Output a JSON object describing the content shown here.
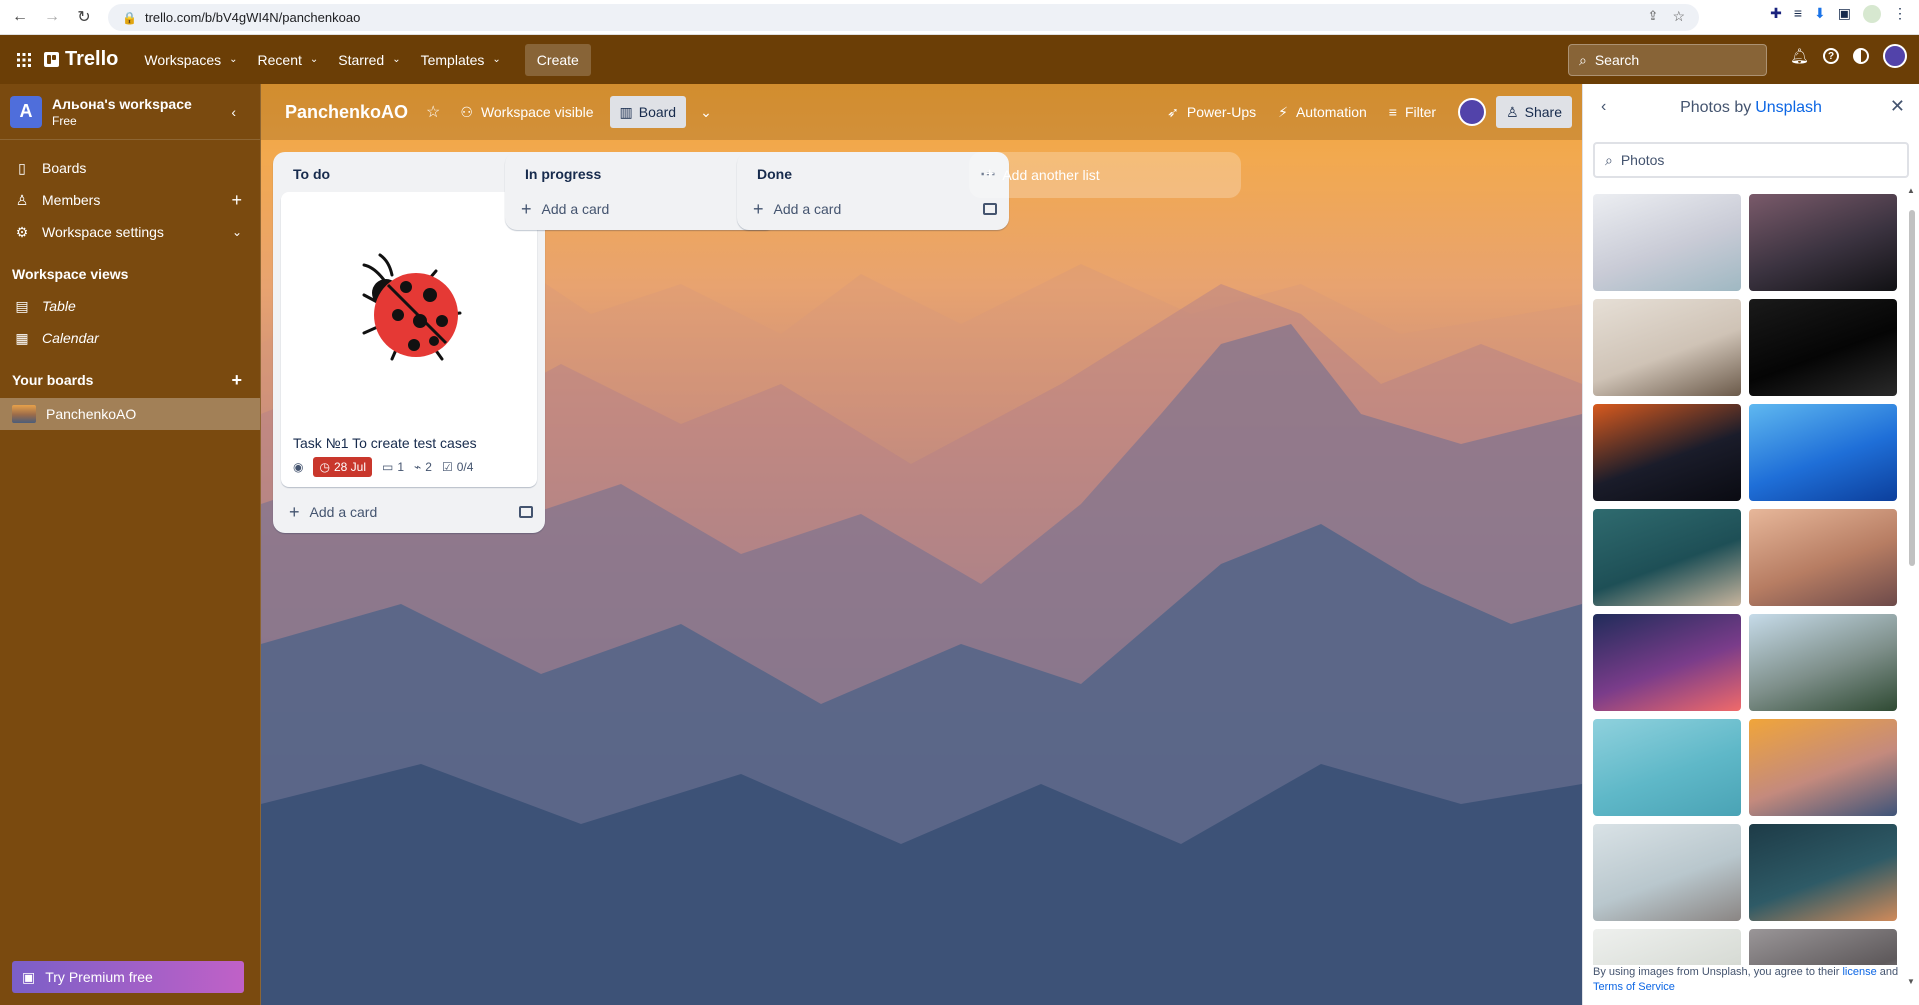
{
  "browser": {
    "url": "trello.com/b/bV4gWI4N/panchenkoao"
  },
  "header": {
    "logo": "Trello",
    "menus": [
      "Workspaces",
      "Recent",
      "Starred",
      "Templates"
    ],
    "create_label": "Create",
    "search_placeholder": "Search"
  },
  "sidebar": {
    "workspace_initial": "A",
    "workspace_name": "Альона's workspace",
    "workspace_plan": "Free",
    "items": [
      {
        "label": "Boards",
        "icon": "board-icon"
      },
      {
        "label": "Members",
        "icon": "person-icon"
      },
      {
        "label": "Workspace settings",
        "icon": "gear-icon"
      }
    ],
    "views_title": "Workspace views",
    "views": [
      {
        "label": "Table",
        "icon": "table-icon"
      },
      {
        "label": "Calendar",
        "icon": "calendar-icon"
      }
    ],
    "boards_title": "Your boards",
    "boards": [
      {
        "label": "PanchenkoAO"
      }
    ],
    "premium_label": "Try Premium free"
  },
  "board": {
    "title": "PanchenkoAO",
    "visibility": "Workspace visible",
    "view": "Board",
    "powerups": "Power-Ups",
    "automation": "Automation",
    "filter": "Filter",
    "share": "Share",
    "lists": [
      {
        "name": "To do",
        "cards": [
          {
            "title": "Task №1 To create test cases",
            "due": "28 Jul",
            "comments": "1",
            "attachments": "2",
            "checklist": "0/4"
          }
        ],
        "add_card": "Add a card"
      },
      {
        "name": "In progress",
        "cards": [],
        "add_card": "Add a card"
      },
      {
        "name": "Done",
        "cards": [],
        "add_card": "Add a card"
      }
    ],
    "add_list": "Add another list"
  },
  "panel": {
    "title_prefix": "Photos by",
    "title_link": "Unsplash",
    "search_placeholder": "Photos",
    "footer_text": "By using images from Unsplash, you agree to their",
    "footer_license": "license",
    "footer_and": "and",
    "footer_terms": "Terms of Service",
    "photos": [
      {
        "name": "photo-silver-waves",
        "colors": [
          "#eceef2",
          "#c9cbd6",
          "#9fb8c2"
        ]
      },
      {
        "name": "photo-dark-mountains-dusk",
        "colors": [
          "#7a5a6a",
          "#3b3340",
          "#111114"
        ]
      },
      {
        "name": "photo-rocky-peak",
        "colors": [
          "#e6dfd6",
          "#cfc3b6",
          "#6b5a4a"
        ]
      },
      {
        "name": "photo-glass-cube",
        "colors": [
          "#1a1a1a",
          "#050505",
          "#2a2a2a"
        ]
      },
      {
        "name": "photo-eclipse-planet",
        "colors": [
          "#d85a1e",
          "#1a1c2a",
          "#0a0b12"
        ]
      },
      {
        "name": "photo-blue-abstract",
        "colors": [
          "#5fb8f0",
          "#1f6fd8",
          "#0c3f9c"
        ]
      },
      {
        "name": "photo-teal-sea-rock",
        "colors": [
          "#2f6b6f",
          "#1e4f56",
          "#c7b49d"
        ]
      },
      {
        "name": "photo-sunset-mountain",
        "colors": [
          "#e7b79a",
          "#b77d63",
          "#6d4a4a"
        ]
      },
      {
        "name": "photo-dark-gradient",
        "colors": [
          "#202c5a",
          "#7a3c8a",
          "#f06a6a"
        ]
      },
      {
        "name": "photo-snowy-forest",
        "colors": [
          "#c6dbe9",
          "#7e8f8a",
          "#2f4a33"
        ]
      },
      {
        "name": "photo-palm-trees",
        "colors": [
          "#8fd1dd",
          "#5fb8c8",
          "#4aa3b5"
        ]
      },
      {
        "name": "photo-orange-ridges",
        "colors": [
          "#f0a53a",
          "#c48a7d",
          "#3f5479"
        ]
      },
      {
        "name": "photo-misty-peak",
        "colors": [
          "#d9e2e6",
          "#b9c7cd",
          "#8a8583"
        ]
      },
      {
        "name": "photo-teal-circles",
        "colors": [
          "#1d3b47",
          "#2e5a66",
          "#d08a5a"
        ]
      },
      {
        "name": "photo-pale-mist",
        "colors": [
          "#eef0ee",
          "#d8dcd6",
          "#b8bcb3"
        ]
      },
      {
        "name": "photo-grey-fog",
        "colors": [
          "#9a9698",
          "#5f5a5c",
          "#cfcacb"
        ]
      }
    ]
  }
}
